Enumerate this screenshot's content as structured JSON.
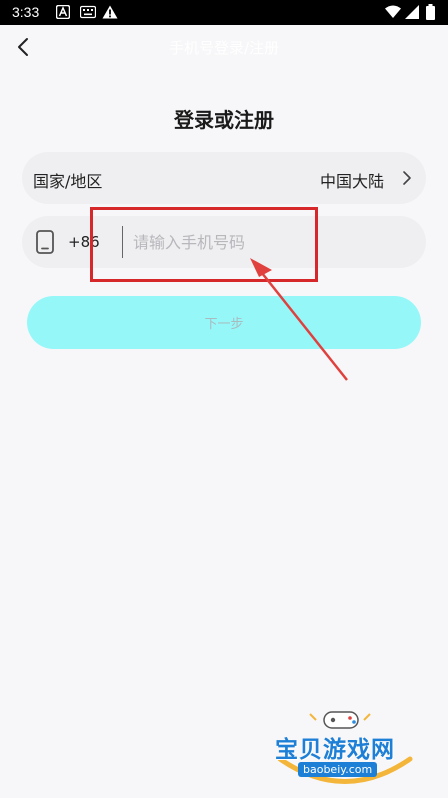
{
  "status_bar": {
    "time": "3:33",
    "left_icons": [
      "a-notification-icon",
      "keyboard-icon",
      "warning-icon"
    ],
    "right_icons": [
      "wifi-icon",
      "signal-icon",
      "battery-icon"
    ]
  },
  "top_bar": {
    "title": "手机号登录/注册"
  },
  "heading": "登录或注册",
  "region": {
    "label": "国家/地区",
    "value": "中国大陆"
  },
  "phone": {
    "country_code": "+86",
    "placeholder": "请输入手机号码",
    "value": ""
  },
  "next_button": {
    "label": "下一步"
  },
  "watermark": {
    "text": "宝贝游戏网",
    "url": "baobeiy.com"
  },
  "colors": {
    "background": "#f7f7f9",
    "field_background": "#efeff1",
    "button_background": "#96f7f9",
    "annotation": "#d6272b"
  }
}
